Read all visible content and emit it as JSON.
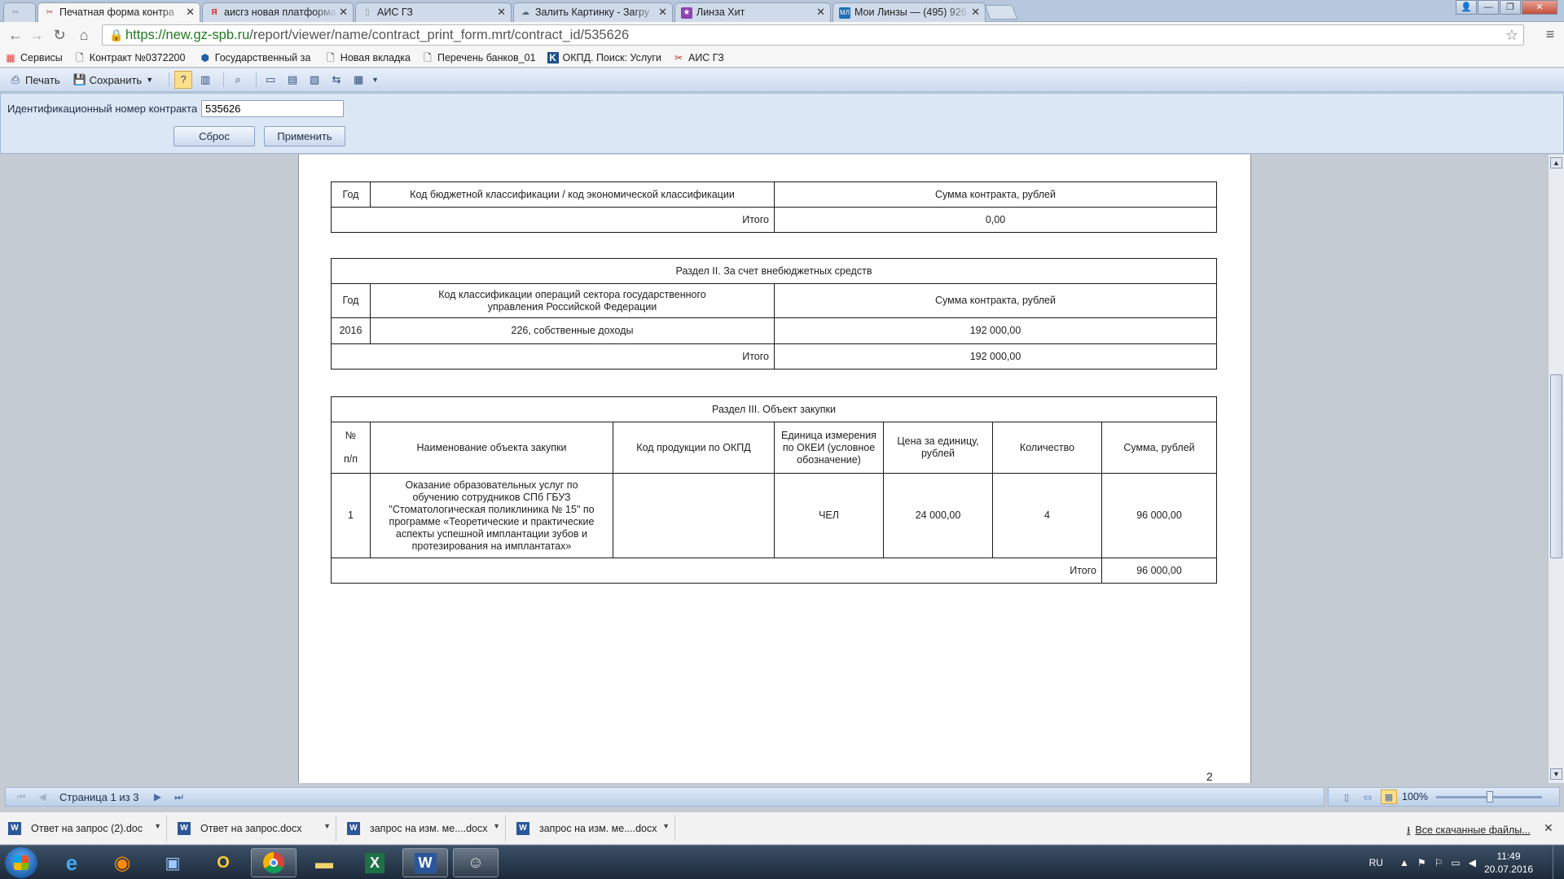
{
  "browser": {
    "tabs": [
      {
        "title": "",
        "icon": "tool-icon",
        "icon_color": "#8a8f99"
      },
      {
        "title": "Печатная форма контра",
        "icon": "tool-icon",
        "icon_color": "#c0392b",
        "active": true
      },
      {
        "title": "аисгз новая платформа",
        "icon": "yandex-icon",
        "icon_color": "#e52620"
      },
      {
        "title": "АИС ГЗ",
        "icon": "doc-icon",
        "icon_color": "#8a8f99"
      },
      {
        "title": "Залить Картинку - Загру",
        "icon": "cloud-icon",
        "icon_color": "#5a6b7d"
      },
      {
        "title": "Линза Хит",
        "icon": "star-icon",
        "icon_color": "#8e44ad"
      },
      {
        "title": "Мои Линзы — (495) 926",
        "icon": "ml-icon",
        "icon_color": "#1f6fb5"
      }
    ],
    "url_host": "https://new.gz-spb.ru",
    "url_path": "/report/viewer/name/contract_print_form.mrt/contract_id/535626",
    "bookmarks": [
      {
        "label": "Сервисы",
        "icon": "apps-icon"
      },
      {
        "label": "Контракт №0372200",
        "icon": "page-icon"
      },
      {
        "label": "Государственный за",
        "icon": "globe-icon"
      },
      {
        "label": "Новая вкладка",
        "icon": "page-icon"
      },
      {
        "label": "Перечень банков_01",
        "icon": "page-icon"
      },
      {
        "label": "ОКПД. Поиск: Услуги",
        "icon": "k-icon"
      },
      {
        "label": "АИС ГЗ",
        "icon": "tool-icon"
      }
    ]
  },
  "toolbar": {
    "print_label": "Печать",
    "save_label": "Сохранить"
  },
  "params": {
    "label": "Идентификационный номер контракта",
    "value": "535626",
    "reset_label": "Сброс",
    "apply_label": "Применить"
  },
  "report": {
    "t1": {
      "h_year": "Год",
      "h_code": "Код бюджетной классификации / код экономической классификации",
      "h_sum": "Сумма контракта, рублей",
      "total_label": "Итого",
      "total_value": "0,00"
    },
    "t2": {
      "title": "Раздел II. За счет внебюджетных средств",
      "h_year": "Год",
      "h_code": "Код классификации операций сектора государственного управления Российской Федерации",
      "h_sum": "Сумма контракта, рублей",
      "row_year": "2016",
      "row_code": "226, собственные доходы",
      "row_sum": "192 000,00",
      "total_label": "Итого",
      "total_value": "192 000,00"
    },
    "t3": {
      "title": "Раздел III. Объект закупки",
      "h_num_1": "№",
      "h_num_2": "п/п",
      "h_name": "Наименование объекта закупки",
      "h_okpd": "Код продукции по ОКПД",
      "h_unit": "Единица измерения по ОКЕИ (условное обозначение)",
      "h_price": "Цена за единицу, рублей",
      "h_qty": "Количество",
      "h_sum": "Сумма, рублей",
      "row_num": "1",
      "row_name": "Оказание образовательных услуг по обучению сотрудников СПб ГБУЗ \"Стоматологическая поликлиника № 15\" по программе «Теоретические и практические аспекты успешной имплантации зубов и протезирования на имплантатах»",
      "row_okpd": "",
      "row_unit": "ЧЕЛ",
      "row_price": "24 000,00",
      "row_qty": "4",
      "row_sum": "96 000,00",
      "total_label": "Итого",
      "total_value": "96 000,00"
    },
    "page_number": "2"
  },
  "viewer_status": {
    "page_label": "Страница 1 из 3",
    "zoom": "100%"
  },
  "downloads": {
    "items": [
      "Ответ на запрос (2).doc",
      "Ответ на запрос.docx",
      "запрос на изм. ме....docx",
      "запрос на изм. ме....docx"
    ],
    "all_label": "Все скачанные файлы..."
  },
  "taskbar": {
    "lang": "RU",
    "time": "11:49",
    "date": "20.07.2016"
  }
}
